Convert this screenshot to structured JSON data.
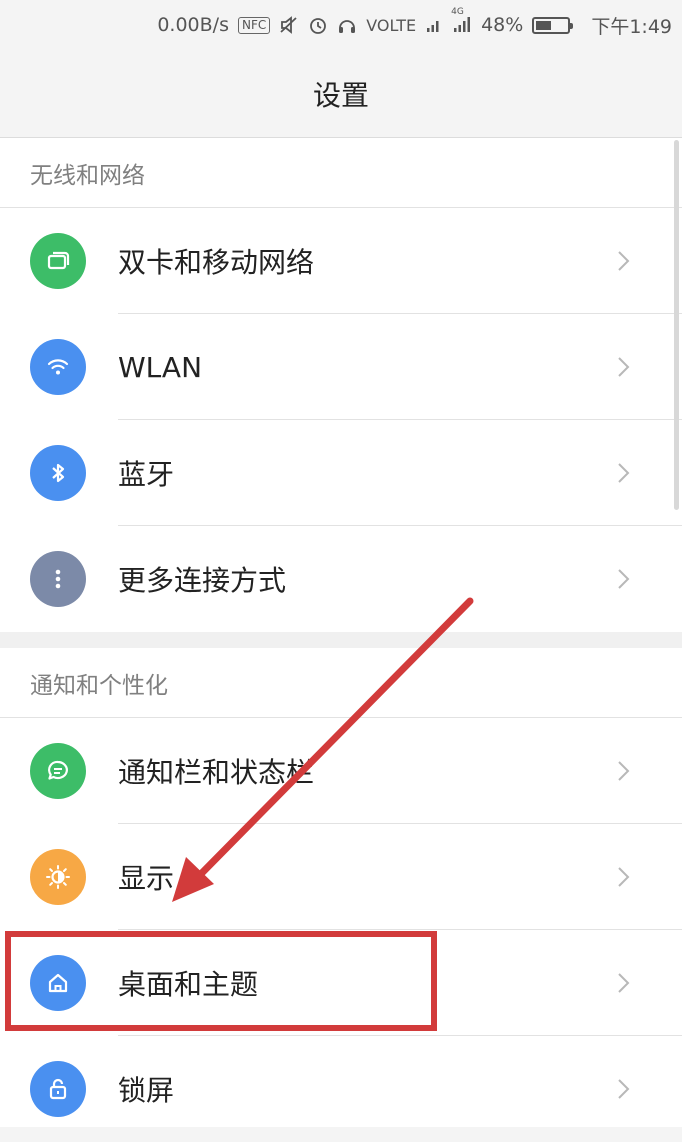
{
  "status_bar": {
    "network_speed": "0.00B/s",
    "nfc": "NFC",
    "volte": "VOLTE",
    "network_type": "4G",
    "battery": "48%",
    "battery_level": 0.48,
    "time": "下午1:49"
  },
  "page": {
    "title": "设置"
  },
  "sections": [
    {
      "header": "无线和网络",
      "items": [
        {
          "label": "双卡和移动网络",
          "icon": "sim-card-icon",
          "color": "#3dbd68"
        },
        {
          "label": "WLAN",
          "icon": "wifi-icon",
          "color": "#4a90f0"
        },
        {
          "label": "蓝牙",
          "icon": "bluetooth-icon",
          "color": "#4a90f0"
        },
        {
          "label": "更多连接方式",
          "icon": "more-dots-icon",
          "color": "#7c8aa8"
        }
      ]
    },
    {
      "header": "通知和个性化",
      "items": [
        {
          "label": "通知栏和状态栏",
          "icon": "message-icon",
          "color": "#3dbd68"
        },
        {
          "label": "显示",
          "icon": "brightness-icon",
          "color": "#f7a845"
        },
        {
          "label": "桌面和主题",
          "icon": "home-icon",
          "color": "#4a90f0"
        },
        {
          "label": "锁屏",
          "icon": "lock-icon",
          "color": "#4a90f0"
        }
      ]
    }
  ],
  "colors": {
    "annotation_red": "#d23b3b"
  }
}
